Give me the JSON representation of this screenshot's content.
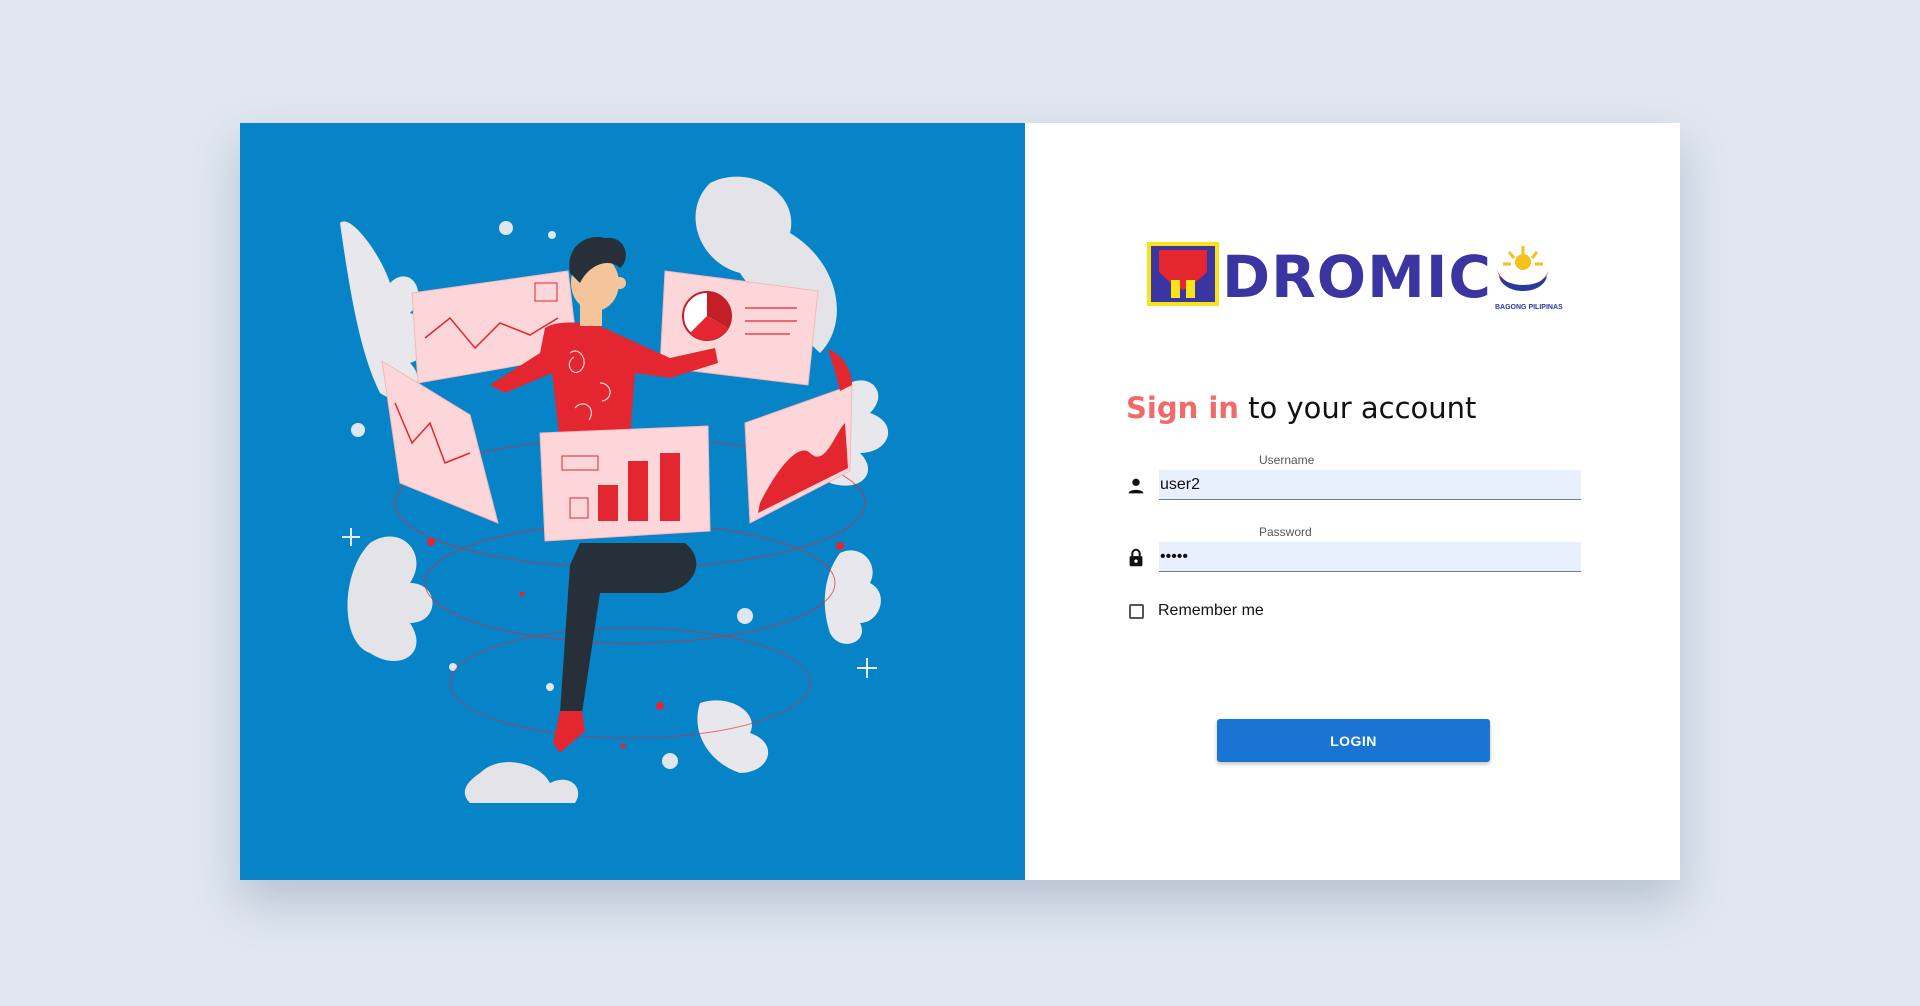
{
  "logo": {
    "text": "DROMIC",
    "subtext": "BAGONG PILIPINAS"
  },
  "heading": {
    "accent": "Sign in",
    "rest": "to your account"
  },
  "username": {
    "label": "Username",
    "value": "user2",
    "icon": "person-icon"
  },
  "password": {
    "label": "Password",
    "value": "•••••",
    "icon": "lock-icon"
  },
  "remember": {
    "label": "Remember me",
    "checked": false
  },
  "login": {
    "label": "LOGIN"
  },
  "colors": {
    "page_bg": "#e0e7f0",
    "left_panel": "#0784c7",
    "brand": "#3a35a0",
    "accent": "#f06a6a",
    "button": "#1a74d2",
    "input_bg": "#e8f0fd"
  }
}
